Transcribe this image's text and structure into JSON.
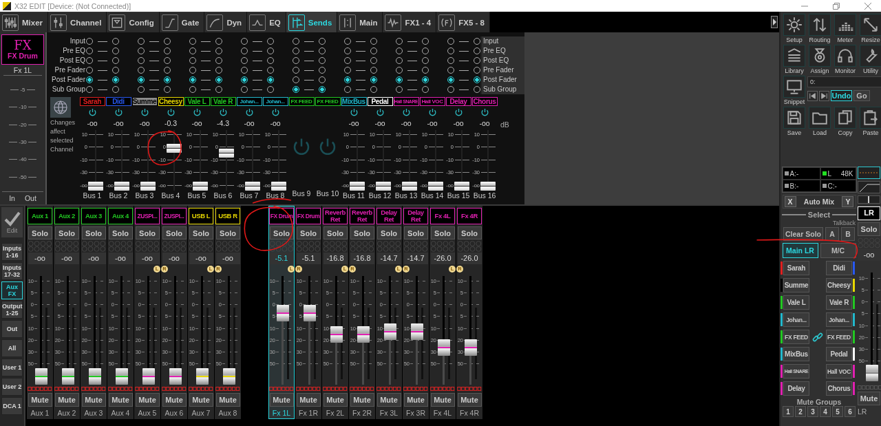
{
  "window": {
    "title": "X32 EDIT [Device: (Not Connected)]"
  },
  "tabs": [
    {
      "label": "Mixer",
      "selected": false
    },
    {
      "label": "Channel",
      "selected": false
    },
    {
      "label": "Config",
      "selected": false
    },
    {
      "label": "Gate",
      "selected": false
    },
    {
      "label": "Dyn",
      "selected": false
    },
    {
      "label": "EQ",
      "selected": false
    },
    {
      "label": "Sends",
      "selected": true
    },
    {
      "label": "Main",
      "selected": false
    },
    {
      "label": "FX1 - 4",
      "selected": false
    },
    {
      "label": "FX5 - 8",
      "selected": false
    }
  ],
  "channel": {
    "logo": "FX",
    "name": "FX Drum",
    "label": "Fx 1L",
    "meter_scale": [
      "-5",
      "-10",
      "-20",
      "-30",
      "-40",
      "-50"
    ],
    "meter_labels": [
      "In",
      "Out"
    ]
  },
  "sends": {
    "tap_labels_left": [
      "Input",
      "Pre EQ",
      "Post EQ",
      "Pre Fader",
      "Post Fader",
      "Sub Group"
    ],
    "tap_labels_right": [
      "Input",
      "Pre EQ",
      "Post EQ",
      "Pre Fader",
      "Post Fader",
      "Sub Group"
    ],
    "pairs": [
      {
        "selected": [
          false,
          false,
          false,
          false,
          true,
          false
        ]
      },
      {
        "selected": [
          false,
          false,
          false,
          false,
          true,
          false
        ]
      },
      {
        "selected": [
          false,
          false,
          false,
          false,
          true,
          false
        ]
      },
      {
        "selected": [
          false,
          false,
          false,
          false,
          true,
          false
        ]
      },
      {
        "selected": [
          false,
          false,
          false,
          false,
          false,
          true
        ]
      },
      {
        "selected": [
          false,
          false,
          false,
          false,
          true,
          false
        ]
      },
      {
        "selected": [
          false,
          false,
          false,
          false,
          true,
          false
        ]
      },
      {
        "selected": [
          false,
          false,
          false,
          false,
          true,
          false
        ]
      }
    ],
    "note": "Changes affect selected Channel",
    "unit": "dB",
    "buses": [
      {
        "kind": "fader",
        "name": "Sarah",
        "color": "#e02020",
        "on": true,
        "value": "-oo",
        "level": 0,
        "scale": [
          "10",
          "0",
          "-10",
          "-30",
          "-oo"
        ],
        "label": "Bus 1"
      },
      {
        "kind": "fader",
        "name": "Didi",
        "color": "#2858f0",
        "on": true,
        "value": "-oo",
        "level": 0,
        "scale": [
          "10",
          "0",
          "-10",
          "-30",
          "-oo"
        ],
        "label": "Bus 2"
      },
      {
        "kind": "fader",
        "name": "Summe",
        "color": "#000000",
        "on": true,
        "value": "-oo",
        "level": 0,
        "scale": [
          "10",
          "0",
          "-10",
          "-30",
          "-oo"
        ],
        "label": "Bus 3"
      },
      {
        "kind": "fader",
        "name": "Cheesy",
        "color": "#e8d800",
        "on": true,
        "value": "-0.3",
        "level": 0.74,
        "scale": [
          "10",
          "0",
          "-10",
          "-30",
          "-oo"
        ],
        "label": "Bus 4"
      },
      {
        "kind": "fader",
        "name": "Vale L",
        "color": "#22c822",
        "on": true,
        "value": "-oo",
        "level": 0,
        "scale": [
          "10",
          "0",
          "-10",
          "-30",
          "-oo"
        ],
        "label": "Bus 5"
      },
      {
        "kind": "fader",
        "name": "Vale R",
        "color": "#22c822",
        "on": true,
        "value": "-4.3",
        "level": 0.64,
        "scale": [
          "10",
          "0",
          "-10",
          "-30",
          "-oo"
        ],
        "label": "Bus 6"
      },
      {
        "kind": "fader",
        "name": "Johan...",
        "color": "#22b8cc",
        "on": true,
        "value": "-oo",
        "level": 0,
        "scale": [
          "10",
          "0",
          "-10",
          "-30",
          "-oo"
        ],
        "label": "Bus 7"
      },
      {
        "kind": "fader",
        "name": "Johan...",
        "color": "#22b8cc",
        "on": true,
        "value": "-oo",
        "level": 0,
        "scale": [
          "10",
          "0",
          "-10",
          "-30",
          "-oo"
        ],
        "label": "Bus 8"
      },
      {
        "kind": "power",
        "name": "FX FEED",
        "color": "#22c822",
        "on": false,
        "label": "Bus 9"
      },
      {
        "kind": "power",
        "name": "FX FEED",
        "color": "#22c822",
        "on": false,
        "label": "Bus 10"
      },
      {
        "kind": "fader",
        "name": "MixBus",
        "color": "#22b8cc",
        "on": true,
        "value": "-oo",
        "level": 0,
        "scale": [
          "10",
          "0",
          "-10",
          "-30",
          "-oo"
        ],
        "label": "Bus 11"
      },
      {
        "kind": "fader",
        "name": "Pedal",
        "color": "#ffffff",
        "on": true,
        "value": "-oo",
        "level": 0,
        "scale": [
          "10",
          "0",
          "-10",
          "-30",
          "-oo"
        ],
        "label": "Bus 12"
      },
      {
        "kind": "fader",
        "name": "Hall SNARE",
        "color": "#e020b0",
        "on": true,
        "value": "-oo",
        "level": 0,
        "scale": [
          "10",
          "0",
          "-10",
          "-30",
          "-oo"
        ],
        "label": "Bus 13"
      },
      {
        "kind": "fader",
        "name": "Hall VOC",
        "color": "#e020b0",
        "on": true,
        "value": "-oo",
        "level": 0,
        "scale": [
          "10",
          "0",
          "-10",
          "-30",
          "-oo"
        ],
        "label": "Bus 14"
      },
      {
        "kind": "fader",
        "name": "Delay",
        "color": "#e020b0",
        "on": true,
        "value": "-oo",
        "level": 0,
        "scale": [
          "10",
          "0",
          "-10",
          "-30",
          "-oo"
        ],
        "label": "Bus 15"
      },
      {
        "kind": "fader",
        "name": "Chorus",
        "color": "#e020b0",
        "on": true,
        "value": "-oo",
        "level": 0,
        "scale": [
          "10",
          "0",
          "-10",
          "-30",
          "-oo"
        ],
        "label": "Bus 16"
      }
    ]
  },
  "nav": {
    "edit": "Edit",
    "items": [
      {
        "label": "Inputs 1-16",
        "selected": false
      },
      {
        "label": "Inputs 17-32",
        "selected": false
      },
      {
        "label": "Aux FX",
        "selected": true
      },
      {
        "label": "Output 1-25",
        "selected": false
      },
      {
        "label": "Out",
        "selected": false
      },
      {
        "label": "All",
        "selected": false
      },
      {
        "label": "User 1",
        "selected": false
      },
      {
        "label": "User 2",
        "selected": false
      },
      {
        "label": "DCA 1",
        "selected": false
      }
    ]
  },
  "strip_groups": [
    {
      "strips": [
        {
          "name": "Aux 1",
          "color": "#22c822",
          "solo": "Solo",
          "value": "-oo",
          "scale": [
            "10",
            "5",
            "0",
            "5",
            "10",
            "20",
            "30",
            "50"
          ],
          "level": 0.07,
          "mute": "Mute",
          "label": "Aux 1",
          "selected": false
        },
        {
          "name": "Aux 2",
          "color": "#22c822",
          "solo": "Solo",
          "value": "-oo",
          "scale": [
            "10",
            "5",
            "0",
            "5",
            "10",
            "20",
            "30",
            "50"
          ],
          "level": 0.07,
          "mute": "Mute",
          "label": "Aux 2",
          "selected": false
        },
        {
          "name": "Aux 3",
          "color": "#22c822",
          "solo": "Solo",
          "value": "-oo",
          "scale": [
            "10",
            "5",
            "0",
            "5",
            "10",
            "20",
            "30",
            "50"
          ],
          "level": 0.07,
          "mute": "Mute",
          "label": "Aux 3",
          "selected": false
        },
        {
          "name": "Aux 4",
          "color": "#22c822",
          "solo": "Solo",
          "value": "-oo",
          "scale": [
            "10",
            "5",
            "0",
            "5",
            "10",
            "20",
            "30",
            "50"
          ],
          "level": 0.07,
          "mute": "Mute",
          "label": "Aux 4",
          "selected": false
        },
        {
          "name": "ZUSPI...",
          "color": "#e020b0",
          "solo": "Solo",
          "value": "-oo",
          "badge": "L",
          "scale": [
            "10",
            "5",
            "0",
            "5",
            "10",
            "20",
            "30",
            "50"
          ],
          "level": 0.07,
          "mute": "Mute",
          "label": "Aux 5",
          "selected": false
        },
        {
          "name": "ZUSPI...",
          "color": "#e020b0",
          "solo": "Solo",
          "value": "-oo",
          "badge": "R",
          "scale": [
            "10",
            "5",
            "0",
            "5",
            "10",
            "20",
            "30",
            "50"
          ],
          "level": 0.07,
          "mute": "Mute",
          "label": "Aux 6",
          "selected": false
        },
        {
          "name": "USB L",
          "color": "#e8d800",
          "solo": "Solo",
          "value": "-oo",
          "badge": "L",
          "scale": [
            "10",
            "5",
            "0",
            "5",
            "10",
            "20",
            "30",
            "50"
          ],
          "level": 0.07,
          "mute": "Mute",
          "label": "Aux 7",
          "selected": false
        },
        {
          "name": "USB R",
          "color": "#e8d800",
          "solo": "Solo",
          "value": "-oo",
          "badge": "R",
          "scale": [
            "10",
            "5",
            "0",
            "5",
            "10",
            "20",
            "30",
            "50"
          ],
          "level": 0.07,
          "mute": "Mute",
          "label": "Aux 8",
          "selected": false
        }
      ]
    },
    {
      "strips": [
        {
          "name": "FX Drum",
          "color": "#e020b0",
          "solo": "Solo",
          "value": "-5.1",
          "badge": "L",
          "scale": [
            "10",
            "5",
            "0",
            "5",
            "10",
            "20",
            "30",
            "50"
          ],
          "level": 0.66,
          "mute": "Mute",
          "label": "Fx 1L",
          "selected": true
        },
        {
          "name": "FX Drum",
          "color": "#e020b0",
          "solo": "Solo",
          "value": "-5.1",
          "badge": "R",
          "scale": [
            "10",
            "5",
            "0",
            "5",
            "10",
            "20",
            "30",
            "50"
          ],
          "level": 0.66,
          "mute": "Mute",
          "label": "Fx 1R",
          "selected": false
        },
        {
          "name": "Reverb Ret",
          "color": "#e020b0",
          "solo": "Solo",
          "value": "-16.8",
          "badge": "L",
          "scale": [
            "10",
            "5",
            "0",
            "5",
            "10",
            "20",
            "30",
            "50"
          ],
          "level": 0.46,
          "mute": "Mute",
          "label": "Fx 2L",
          "selected": false
        },
        {
          "name": "Reverb Ret",
          "color": "#e020b0",
          "solo": "Solo",
          "value": "-16.8",
          "badge": "R",
          "scale": [
            "10",
            "5",
            "0",
            "5",
            "10",
            "20",
            "30",
            "50"
          ],
          "level": 0.46,
          "mute": "Mute",
          "label": "Fx 2R",
          "selected": false
        },
        {
          "name": "Delay Ret",
          "color": "#e020b0",
          "solo": "Solo",
          "value": "-14.7",
          "badge": "L",
          "scale": [
            "10",
            "5",
            "0",
            "5",
            "10",
            "20",
            "30",
            "50"
          ],
          "level": 0.49,
          "mute": "Mute",
          "label": "Fx 3L",
          "selected": false
        },
        {
          "name": "Delay Ret",
          "color": "#e020b0",
          "solo": "Solo",
          "value": "-14.7",
          "badge": "R",
          "scale": [
            "10",
            "5",
            "0",
            "5",
            "10",
            "20",
            "30",
            "50"
          ],
          "level": 0.49,
          "mute": "Mute",
          "label": "Fx 3R",
          "selected": false
        },
        {
          "name": "Fx 4L",
          "color": "#e020b0",
          "solo": "Solo",
          "value": "-26.0",
          "badge": "L",
          "scale": [
            "10",
            "5",
            "0",
            "5",
            "10",
            "20",
            "30",
            "50"
          ],
          "level": 0.34,
          "mute": "Mute",
          "label": "Fx 4L",
          "selected": false
        },
        {
          "name": "Fx 4R",
          "color": "#e020b0",
          "solo": "Solo",
          "value": "-26.0",
          "badge": "R",
          "scale": [
            "10",
            "5",
            "0",
            "5",
            "10",
            "20",
            "30",
            "50"
          ],
          "level": 0.34,
          "mute": "Mute",
          "label": "Fx 4R",
          "selected": false
        }
      ]
    }
  ],
  "tools": [
    {
      "label": "Setup"
    },
    {
      "label": "Routing"
    },
    {
      "label": "Meter"
    },
    {
      "label": "Resize"
    },
    {
      "label": "Library"
    },
    {
      "label": "Assign"
    },
    {
      "label": "Monitor"
    },
    {
      "label": "Utility"
    }
  ],
  "snippet": {
    "label": "Snippet",
    "value": "0:",
    "undo": "Undo",
    "go": "Go"
  },
  "file_tools": [
    {
      "label": "Save"
    },
    {
      "label": "Load"
    },
    {
      "label": "Copy"
    },
    {
      "label": "Paste"
    }
  ],
  "status": [
    {
      "label": "A:-",
      "on": false
    },
    {
      "label": "L",
      "value": "48K",
      "on": true
    },
    {
      "label": "B:-",
      "on": false
    },
    {
      "label": "C:-",
      "on": false
    }
  ],
  "automix": {
    "x": "X",
    "label": "Auto Mix",
    "y": "Y"
  },
  "select": {
    "title": "Select",
    "talkback": "Talkback",
    "clear": "Clear Solo",
    "talk_a": "A",
    "talk_b": "B",
    "main": {
      "label": "Main LR",
      "selected": true
    },
    "mc": {
      "label": "M/C",
      "selected": false
    },
    "rows": [
      {
        "left": {
          "label": "Sarah",
          "color": "#e02020"
        },
        "right": {
          "label": "Didi",
          "color": "#2858f0"
        },
        "linked": false
      },
      {
        "left": {
          "label": "Summe",
          "color": "#000000"
        },
        "right": {
          "label": "Cheesy",
          "color": "#e8d800"
        },
        "linked": false
      },
      {
        "left": {
          "label": "Vale L",
          "color": "#22c822"
        },
        "right": {
          "label": "Vale R",
          "color": "#22c822"
        },
        "linked": false
      },
      {
        "left": {
          "label": "Johan...",
          "color": "#22b8cc"
        },
        "right": {
          "label": "Johan...",
          "color": "#22b8cc"
        },
        "linked": false
      },
      {
        "left": {
          "label": "FX FEED",
          "color": "#22c822"
        },
        "right": {
          "label": "FX FEED",
          "color": "#22c822"
        },
        "linked": true
      },
      {
        "left": {
          "label": "MixBus",
          "color": "#22b8cc"
        },
        "right": {
          "label": "Pedal",
          "color": "#ffffff"
        },
        "linked": false
      },
      {
        "left": {
          "label": "Hall SNARE",
          "color": "#e020b0"
        },
        "right": {
          "label": "Hall VOC",
          "color": "#e020b0"
        },
        "linked": false
      },
      {
        "left": {
          "label": "Delay",
          "color": "#e020b0"
        },
        "right": {
          "label": "Chorus",
          "color": "#e020b0"
        },
        "linked": false
      }
    ],
    "mute_groups_title": "Mute Groups",
    "mute_groups": [
      "1",
      "2",
      "3",
      "4",
      "5",
      "6"
    ]
  },
  "main_strip": {
    "name": "LR",
    "solo": "Solo",
    "value": "-oo",
    "scale": [
      "10",
      "5",
      "0",
      "5",
      "10",
      "20",
      "30",
      "50"
    ],
    "level": 0.07,
    "mute": "Mute",
    "label": "LR"
  },
  "annotations": [
    {
      "kind": "ellipse"
    },
    {
      "kind": "ellipse"
    },
    {
      "kind": "arc"
    },
    {
      "kind": "stroke"
    }
  ]
}
